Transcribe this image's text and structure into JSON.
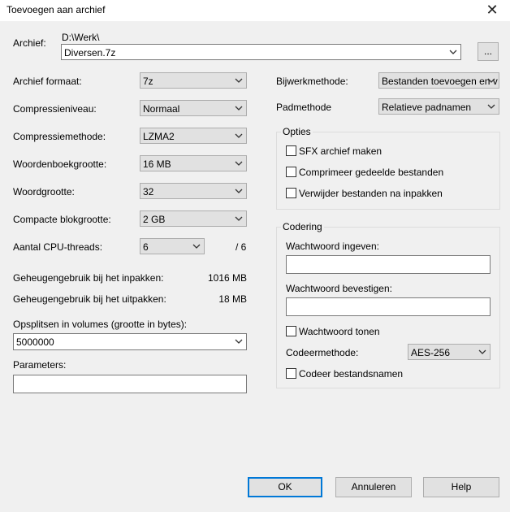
{
  "window": {
    "title": "Toevoegen aan archief",
    "close": "✕"
  },
  "archive": {
    "label": "Archief:",
    "path": "D:\\Werk\\",
    "name": "Diversen.7z",
    "browse": "..."
  },
  "left": {
    "format": {
      "label": "Archief formaat:",
      "value": "7z"
    },
    "level": {
      "label": "Compressieniveau:",
      "value": "Normaal"
    },
    "method": {
      "label": "Compressiemethode:",
      "value": "LZMA2"
    },
    "dict": {
      "label": "Woordenboekgrootte:",
      "value": "16 MB"
    },
    "word": {
      "label": "Woordgrootte:",
      "value": "32"
    },
    "solid": {
      "label": "Compacte blokgrootte:",
      "value": "2 GB"
    },
    "threads": {
      "label": "Aantal CPU-threads:",
      "value": "6",
      "max": "/ 6"
    },
    "mem_pack": {
      "label": "Geheugengebruik bij het inpakken:",
      "value": "1016 MB"
    },
    "mem_unpack": {
      "label": "Geheugengebruik bij het uitpakken:",
      "value": "18 MB"
    },
    "split": {
      "label": "Opsplitsen in volumes (grootte in bytes):",
      "value": "5000000"
    },
    "params": {
      "label": "Parameters:",
      "value": ""
    }
  },
  "right": {
    "update": {
      "label": "Bijwerkmethode:",
      "value": "Bestanden toevoegen en v"
    },
    "path": {
      "label": "Padmethode",
      "value": "Relatieve padnamen"
    },
    "options": {
      "title": "Opties",
      "sfx": "SFX archief maken",
      "shared": "Comprimeer gedeelde bestanden",
      "delete": "Verwijder bestanden na inpakken"
    },
    "encryption": {
      "title": "Codering",
      "pw_label": "Wachtwoord ingeven:",
      "pw_value": "",
      "confirm_label": "Wachtwoord bevestigen:",
      "confirm_value": "",
      "show_pw": "Wachtwoord tonen",
      "method_label": "Codeermethode:",
      "method_value": "AES-256",
      "encrypt_names": "Codeer bestandsnamen"
    }
  },
  "buttons": {
    "ok": "OK",
    "cancel": "Annuleren",
    "help": "Help"
  }
}
